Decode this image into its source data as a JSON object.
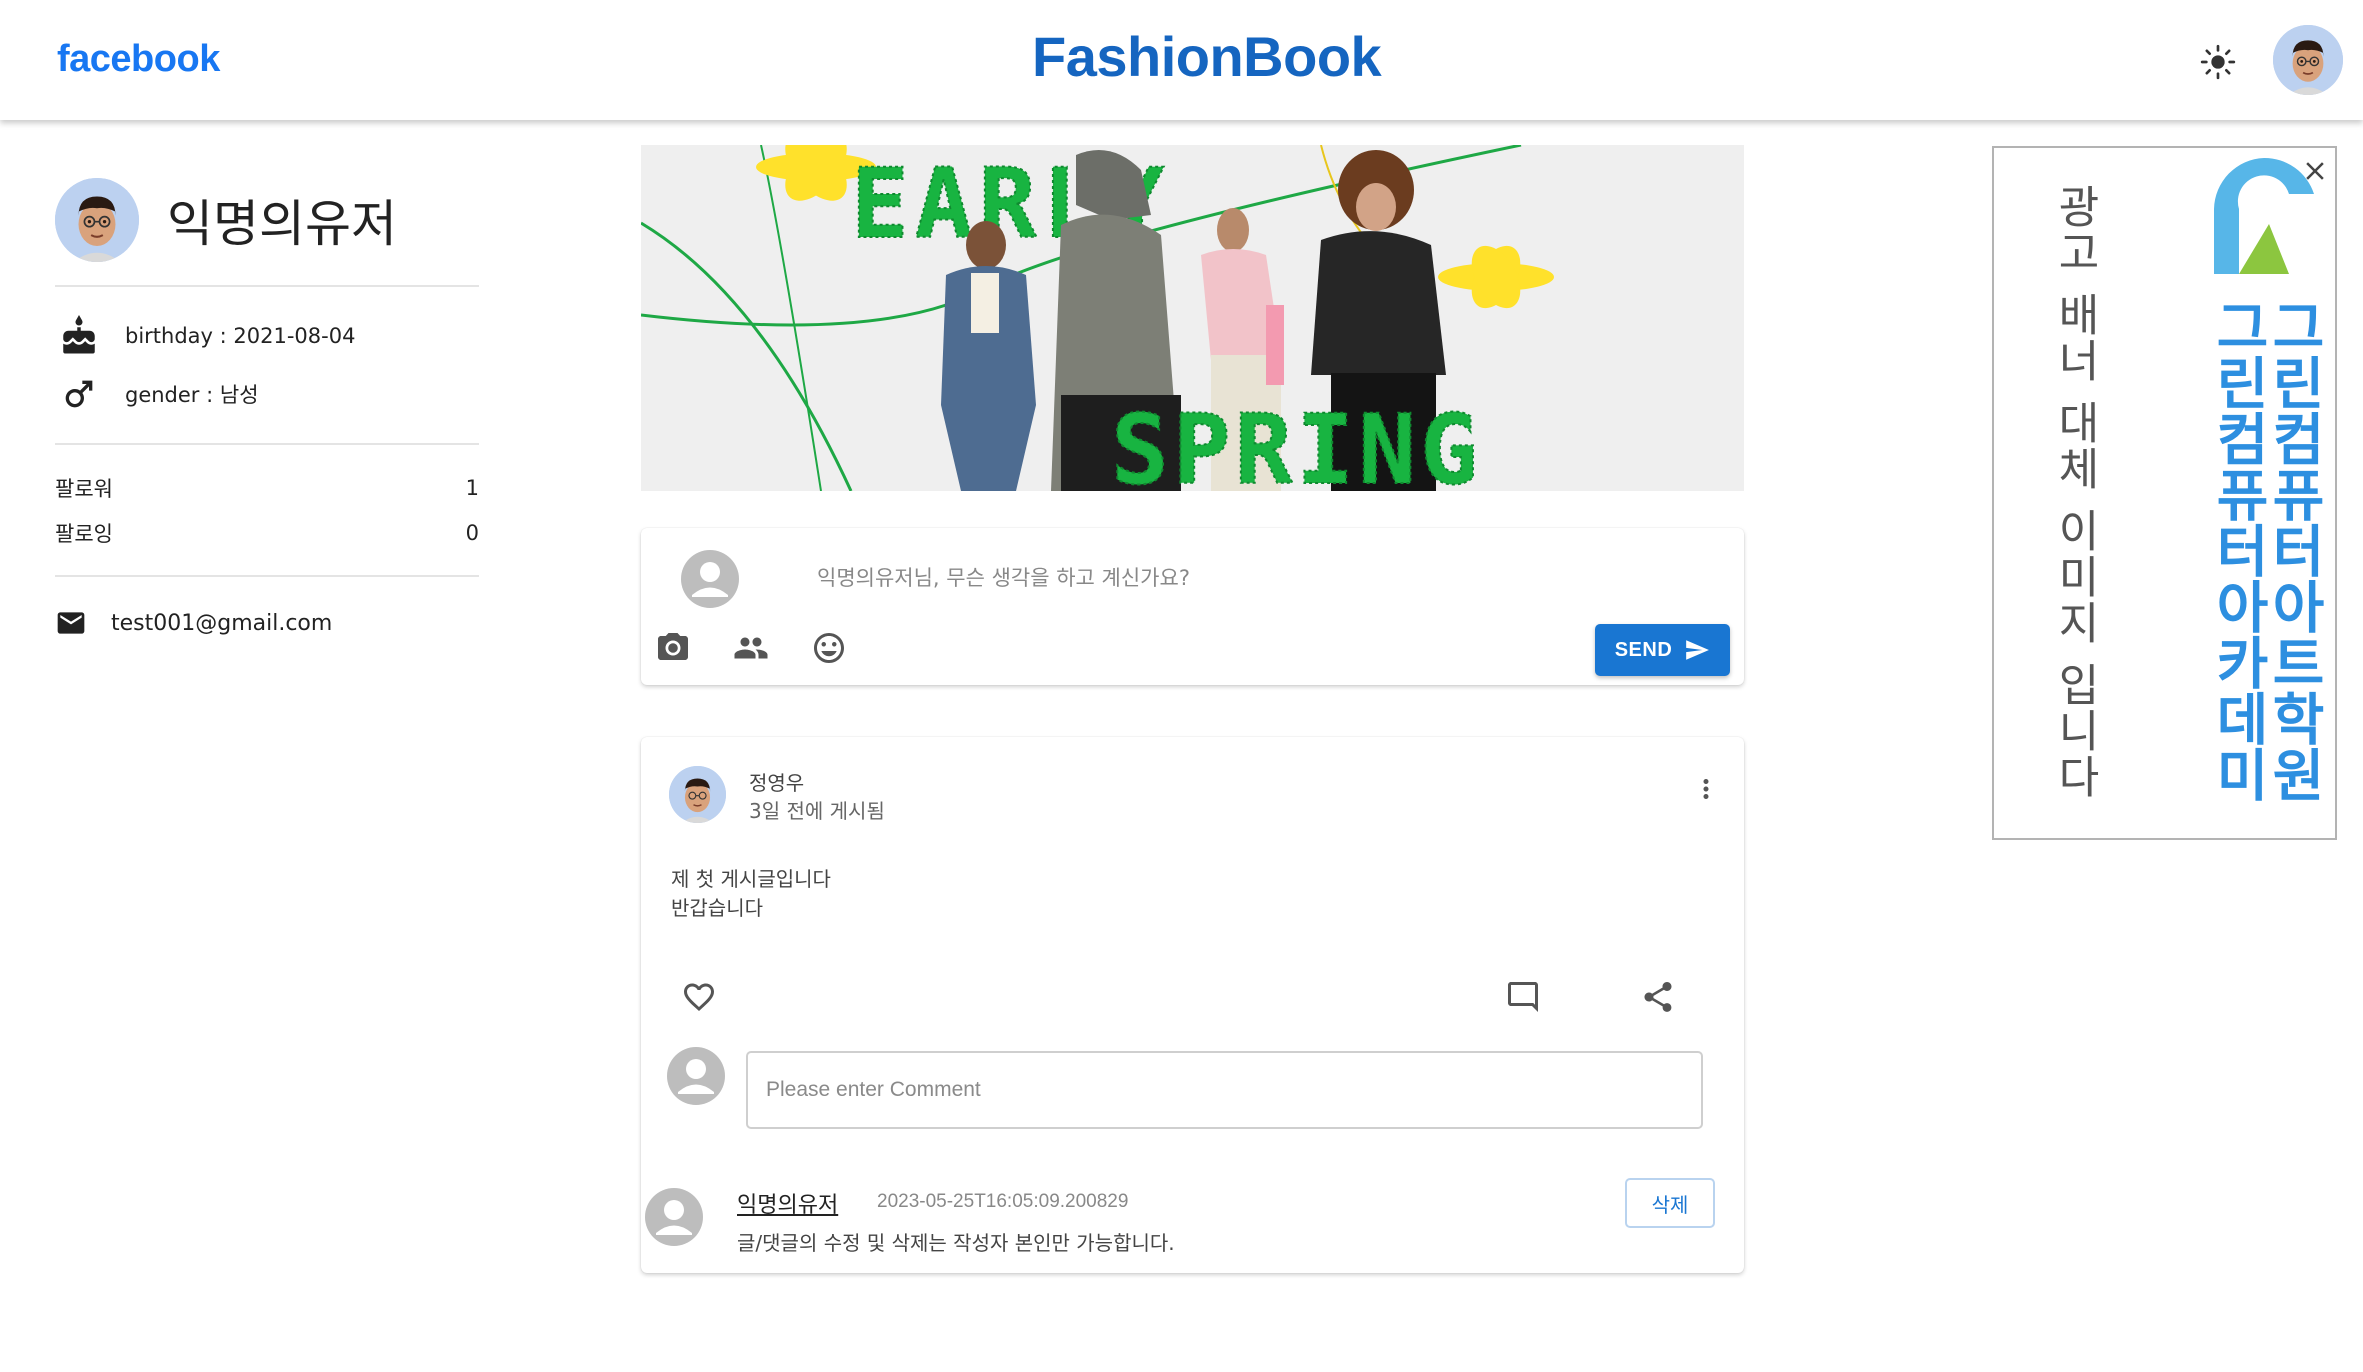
{
  "header": {
    "facebook_logo": "facebook",
    "brand": "FashionBook",
    "theme_toggle_icon": "sun-icon",
    "user_avatar_icon": "memoji-avatar"
  },
  "profile": {
    "name": "익명의유저",
    "birthday": "birthday : 2021-08-04",
    "gender": "gender : 남성",
    "followers_label": "팔로워",
    "followers_count": "1",
    "following_label": "팔로잉",
    "following_count": "0",
    "email": "test001@gmail.com",
    "icons": [
      "cake-icon",
      "male-icon",
      "mail-icon"
    ]
  },
  "banner": {
    "line1": "EARLY",
    "line2": "SPRING",
    "colors": {
      "text": "#18b441",
      "flower": "#ffe12b",
      "background": "#efefef"
    }
  },
  "composer": {
    "placeholder": "익명의유저님, 무슨 생각을 하고 계신가요?",
    "value": "",
    "send_label": "SEND",
    "icons": [
      "camera-icon",
      "people-icon",
      "emoji-icon",
      "send-icon"
    ]
  },
  "post": {
    "author": "정영우",
    "time": "3일 전에 게시됨",
    "body_line1": "제 첫 게시글입니다",
    "body_line2": "반갑습니다",
    "comment_placeholder": "Please enter Comment",
    "comment_value": "",
    "comment": {
      "user": "익명의유저",
      "timestamp": "2023-05-25T16:05:09.200829",
      "text": "글/댓글의 수정 및 삭제는 작성자 본인만 가능합니다.",
      "delete_label": "삭제"
    }
  },
  "ad": {
    "alt_text": "광고 배너 대체 이미지 입니다",
    "brand_text": "그린컴퓨터아카데미",
    "brand_text2": "그린컴퓨터아트학원",
    "colors": {
      "brand": "#2d8fe0",
      "logo_green": "#8cc63f"
    }
  },
  "colors": {
    "accent": "#1976d2",
    "facebook": "#1877f2",
    "brand": "#1565c0"
  }
}
